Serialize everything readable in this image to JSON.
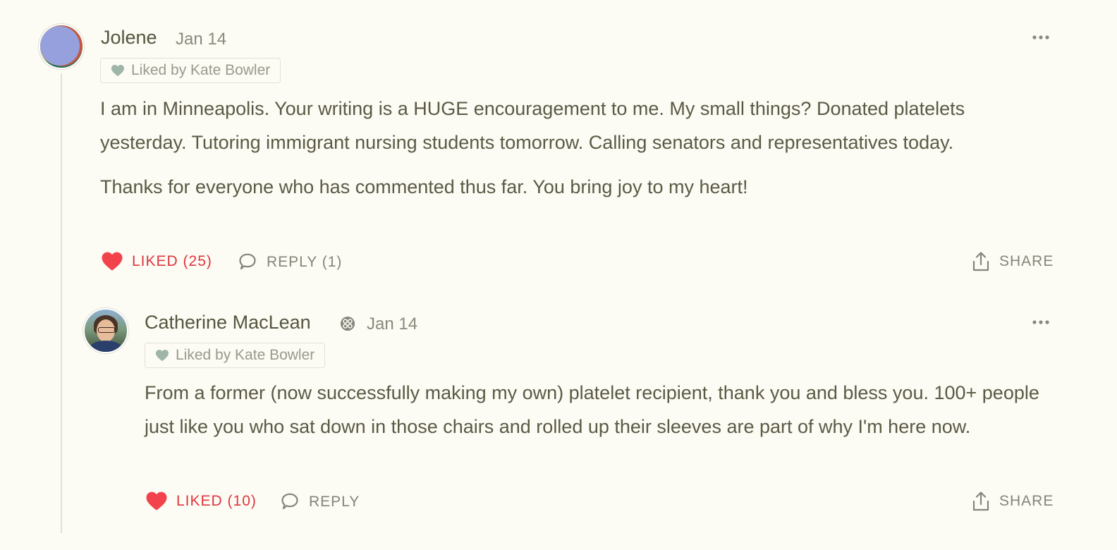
{
  "comments": [
    {
      "author": "Jolene",
      "date": "Jan 14",
      "liked_by": "Liked by Kate Bowler",
      "paragraphs": [
        "I am in Minneapolis. Your writing is a HUGE encouragement to me. My small things? Donated platelets yesterday. Tutoring immigrant nursing students tomorrow. Calling senators and representatives today.",
        "Thanks for everyone who has commented thus far. You bring joy to my heart!"
      ],
      "like_label": "LIKED (25)",
      "reply_label": "REPLY (1)",
      "share_label": "SHARE"
    },
    {
      "author": "Catherine MacLean",
      "date": "Jan 14",
      "liked_by": "Liked by Kate Bowler",
      "paragraphs": [
        "From a former (now successfully making my own) platelet recipient, thank you and bless you. 100+ people just like you who sat down in those chairs and rolled up their sleeves are part of why I'm here now."
      ],
      "like_label": "LIKED (10)",
      "reply_label": "REPLY",
      "share_label": "SHARE"
    }
  ],
  "colors": {
    "background": "#fcfbf4",
    "text": "#5b5a44",
    "liked_red": "#e0363f",
    "muted": "#86857a",
    "liked_by_heart": "#9fb5a8"
  },
  "icons": {
    "more": "more-options-icon",
    "heart": "heart-icon",
    "reply": "speech-bubble-icon",
    "share": "share-upload-icon",
    "badge": "subscriber-badge-icon"
  }
}
